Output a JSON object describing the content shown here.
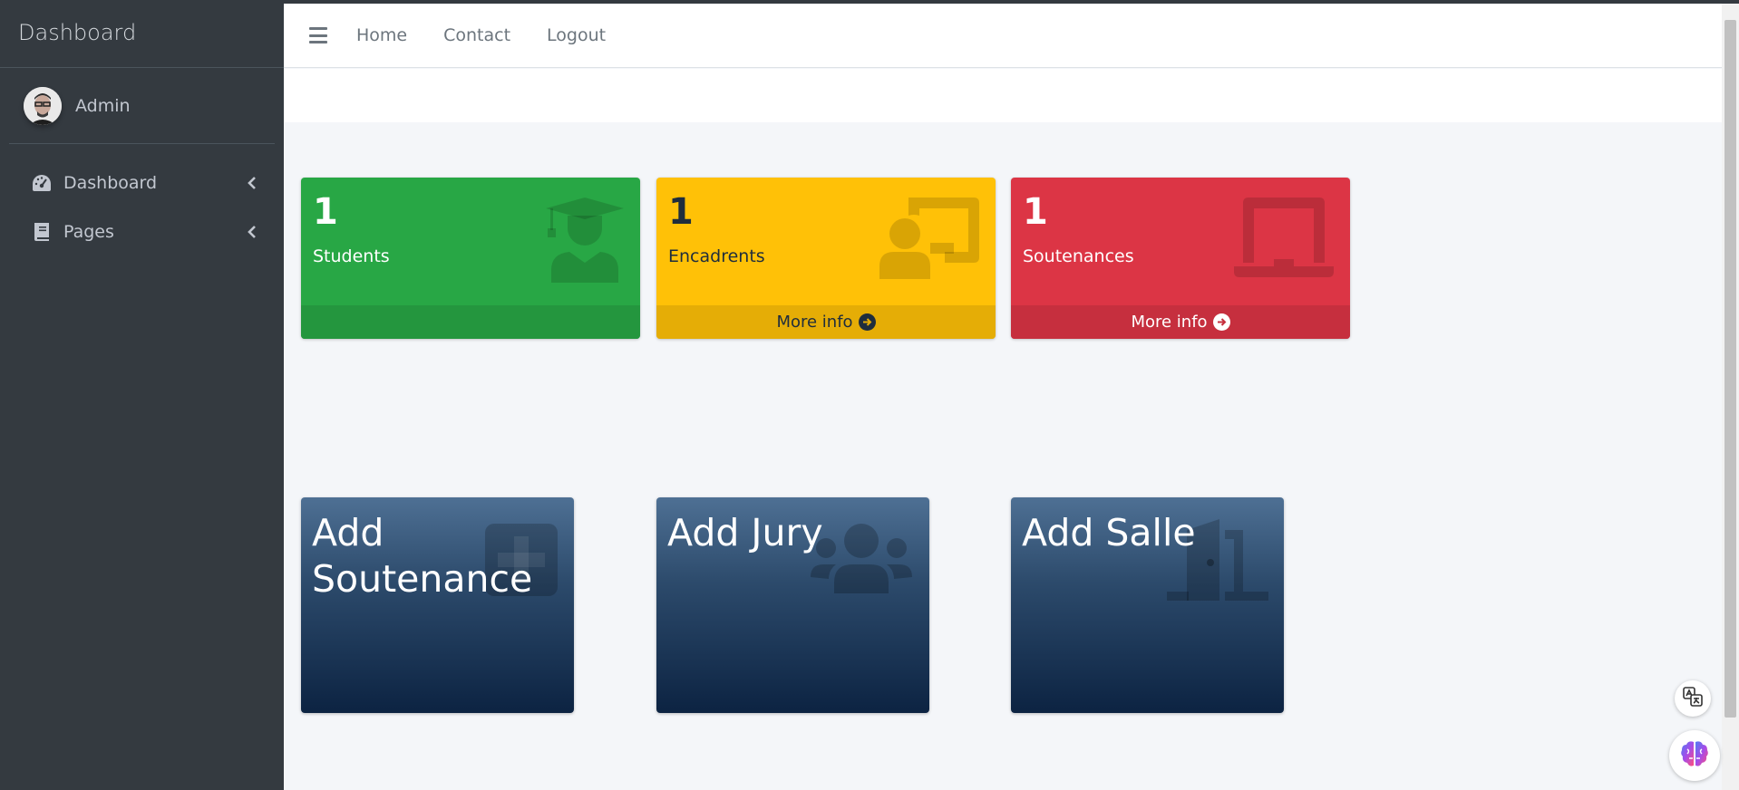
{
  "sidebar": {
    "brand": "Dashboard",
    "user": {
      "name": "Admin"
    },
    "items": [
      {
        "label": "Dashboard",
        "icon": "tachometer-icon"
      },
      {
        "label": "Pages",
        "icon": "book-icon"
      }
    ]
  },
  "navbar": {
    "menu_icon": "hamburger-icon",
    "links": [
      "Home",
      "Contact",
      "Logout"
    ]
  },
  "stats": [
    {
      "count": "1",
      "label": "Students",
      "icon": "graduate-icon",
      "footer": "",
      "color": "#28a745"
    },
    {
      "count": "1",
      "label": "Encadrents",
      "icon": "teacher-icon",
      "footer": "More info",
      "color": "#ffc107"
    },
    {
      "count": "1",
      "label": "Soutenances",
      "icon": "laptop-icon",
      "footer": "More info",
      "color": "#dc3545"
    }
  ],
  "actions": [
    {
      "label": "Add Soutenance",
      "icon": "plus-square-icon"
    },
    {
      "label": "Add Jury",
      "icon": "users-icon"
    },
    {
      "label": "Add Salle",
      "icon": "door-icon"
    }
  ],
  "floating": [
    {
      "icon": "translate-icon"
    },
    {
      "icon": "brain-icon"
    }
  ]
}
